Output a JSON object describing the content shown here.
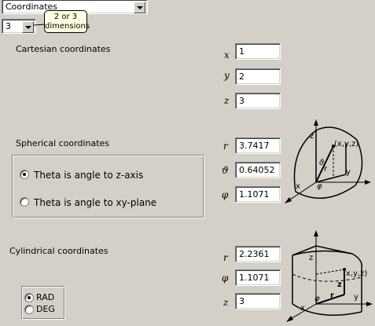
{
  "top_combo": {
    "value": "Coordinates"
  },
  "dim_combo": {
    "value": "3"
  },
  "tooltip": {
    "line1": "2 or 3",
    "line2": "dimensions"
  },
  "cartesian": {
    "heading": "Cartesian coordinates",
    "x_label": "x",
    "y_label": "y",
    "z_label": "z",
    "x": "1",
    "y": "2",
    "z": "3"
  },
  "spherical": {
    "heading": "Spherical coordinates",
    "r_label": "r",
    "theta_label": "ϑ",
    "phi_label": "φ",
    "r": "3.7417",
    "theta": "0.64052",
    "phi": "1.1071",
    "option_z": "Theta is angle to z-axis",
    "option_xy": "Theta is angle to xy-plane",
    "selected": "option_z"
  },
  "cylindrical": {
    "heading": "Cylindrical coordinates",
    "r_label": "r",
    "phi_label": "φ",
    "z_label": "z",
    "r": "2.2361",
    "phi": "1.1071",
    "z": "3"
  },
  "units": {
    "rad": "RAD",
    "deg": "DEG",
    "selected": "rad"
  },
  "diagrams": {
    "sphere": {
      "point": "(x,y,z)",
      "z": "z",
      "theta": "ϑ",
      "r": "r",
      "x": "x",
      "y": "y",
      "phi": "φ"
    },
    "cylinder": {
      "point": "(x,y,z)",
      "z_top": "z",
      "z": "z",
      "r": "r",
      "x": "x",
      "y": "y",
      "phi": "φ"
    }
  },
  "icons": {
    "dropdown": "chevron-down-icon"
  }
}
